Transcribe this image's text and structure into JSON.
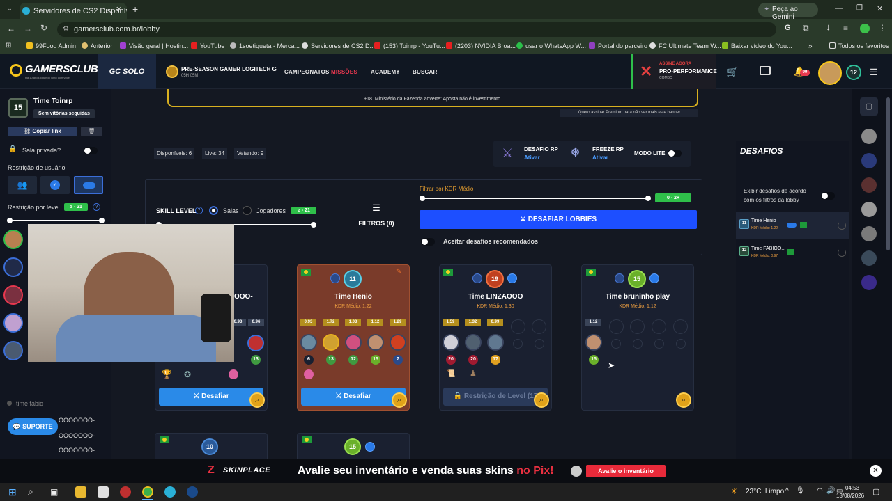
{
  "browser": {
    "tab_title": "Servidores de CS2 Disponíveis",
    "gemini": "Peça ao Gemini",
    "url": "gamersclub.com.br/lobby",
    "bookmarks": [
      "99Food Admin",
      "Anterior",
      "Visão geral | Hostin...",
      "YouTube",
      "1soetiqueta - Merca...",
      "Servidores de CS2 D...",
      "(153) Toinrp - YouTu...",
      "(2203) NVIDIA Broa...",
      "usar o WhatsApp W...",
      "Portal do parceiro",
      "FC Ultimate Team W...",
      "Baixar vídeo do You..."
    ],
    "all_favorites": "Todos os favoritos"
  },
  "header": {
    "logo": "GAMERSCLUB",
    "logo_tagline": "Há 10 anos jogando junto com você",
    "gc_solo": "GC SOLO",
    "preseason_title": "PRE-SEASON GAMER LOGITECH G",
    "preseason_time": "05H 05M",
    "nav": [
      "CAMPEONATOS",
      "MISSÕES",
      "ACADEMY",
      "BUSCAR"
    ],
    "promo_top": "ASSINE AGORA",
    "promo_main": "PRO-PERFORMANCE",
    "promo_sub": "COMBO",
    "notif_count": "99",
    "user_level": "12"
  },
  "left": {
    "team_level": "15",
    "team_name": "Time Toinrp",
    "streak": "Sem vitórias seguidas",
    "copy_link": "Copiar link",
    "private_room": "Sala privada?",
    "user_restriction": "Restrição de usuário",
    "level_restriction": "Restrição por level",
    "level_range": "≥ - 21",
    "chat_placeholder": "time fabio",
    "support": "SUPORTE",
    "chat_lines": [
      "OOOOOOO-",
      "OOOOOOO-",
      "OOOOOOO-"
    ]
  },
  "main": {
    "gambling_notice": "+18. Ministério da Fazenda adverte: Aposta não é investimento.",
    "premium_notice": "Quero assinar Premium para não ver mais este banner",
    "stats": {
      "available": "Disponíveis: 6",
      "live": "Live: 34",
      "vetoing": "Vetando: 9"
    },
    "desafio_rp": "DESAFIO RP",
    "freeze_rp": "FREEZE RP",
    "activate": "Ativar",
    "modo_lite": "MODO LITE",
    "skill_level": "SKILL LEVEL",
    "rooms": "Salas",
    "players": "Jogadores",
    "skill_range": "≥ - 21",
    "filters": "FILTROS (0)",
    "kdr_filter": "Filtrar por KDR Médio",
    "kdr_range": "0 - 2+",
    "challenge_lobbies": "DESAFIAR LOBBIES",
    "accept_recommended": "Aceitar desafios recomendados",
    "partial_name": "OOO-",
    "partial_kdr": [
      "0.93",
      "0.96"
    ],
    "partial_level": "13",
    "partial_button": "Desafiar",
    "cards": [
      {
        "level": "11",
        "name": "Time Henio",
        "kdr": "KDR Médio: 1.22",
        "player_kdrs": [
          "0.93",
          "1.72",
          "1.03",
          "1.12",
          "1.29"
        ],
        "player_levels": [
          "6",
          "13",
          "12",
          "15",
          "7"
        ],
        "button": "Desafiar"
      },
      {
        "level": "19",
        "name": "Time LINZAOOO",
        "kdr": "KDR Médio: 1.30",
        "player_kdrs": [
          "1.59",
          "1.32",
          "0.99"
        ],
        "player_levels": [
          "20",
          "20",
          "17"
        ],
        "button": "Restrição de Level (17"
      },
      {
        "level": "15",
        "name": "Time bruninho play",
        "kdr": "KDR Médio: 1.12",
        "player_kdrs": [
          "1.12"
        ],
        "player_levels": [
          "15"
        ]
      }
    ],
    "bottom_cards": [
      {
        "level": "10"
      },
      {
        "level": "15"
      }
    ]
  },
  "right": {
    "title": "DESAFIOS",
    "toggle_label": "Exibir desafios de acordo com os filtros da lobby",
    "challenges": [
      {
        "level": "11",
        "name": "Time Henio",
        "kdr": "KDR Médio: 1.22"
      },
      {
        "level": "12",
        "name": "Time FABIOO...",
        "kdr": "KDR Médio: 0.97"
      }
    ]
  },
  "banner": {
    "brand": "SKINPLACE",
    "text_pre": "Avalie seu inventário e venda suas skins",
    "text_accent": "no Pix!",
    "cta": "Avalie o inventário"
  },
  "taskbar": {
    "weather": "23°C  Limpo",
    "time": "04:53",
    "date": "13/08/2026"
  },
  "colors": {
    "accent_blue": "#1d4fff",
    "gc_yellow": "#f6c51b",
    "green": "#2fbf4a",
    "orange": "#e8521d",
    "card_highlight": "#7a3b2a"
  }
}
